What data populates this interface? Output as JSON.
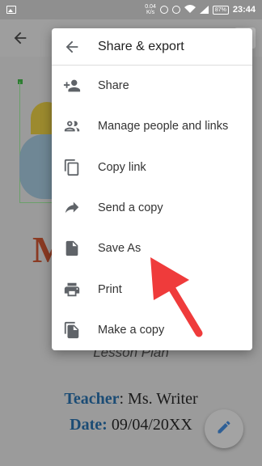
{
  "status_bar": {
    "speed": "0.04\nK/s",
    "battery": "87%",
    "time": "23:44"
  },
  "app_bar": {
    "back_icon": "arrow-left-icon"
  },
  "menu": {
    "title": "Share & export",
    "items": [
      {
        "label": "Share",
        "icon": "person-add-icon"
      },
      {
        "label": "Manage people and links",
        "icon": "people-icon"
      },
      {
        "label": "Copy link",
        "icon": "copy-icon"
      },
      {
        "label": "Send a copy",
        "icon": "forward-arrow-icon"
      },
      {
        "label": "Save As",
        "icon": "file-icon"
      },
      {
        "label": "Print",
        "icon": "printer-icon"
      },
      {
        "label": "Make a copy",
        "icon": "file-copy-icon"
      }
    ]
  },
  "document": {
    "big_letter": "M",
    "subtitle": "Lesson Plan",
    "teacher_key": "Teacher",
    "teacher_value": ": Ms. Writer",
    "date_key": "Date:",
    "date_value": " 09/04/20XX"
  },
  "colors": {
    "annotation_arrow": "#ef3b3b",
    "doc_heading": "#8a3a22",
    "doc_key": "#1b4c75"
  }
}
